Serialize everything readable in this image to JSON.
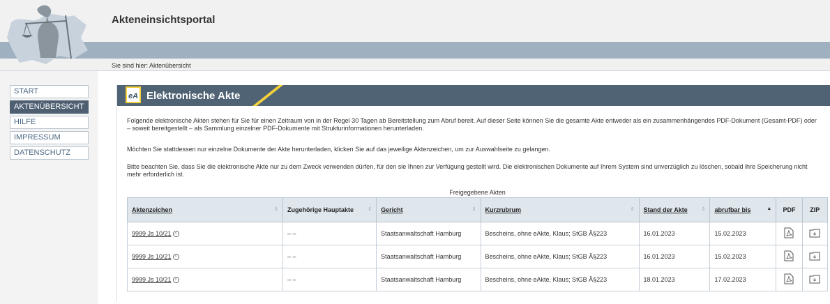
{
  "header": {
    "title": "Akteneinsichtsportal",
    "breadcrumb_label": "Sie sind hier:",
    "breadcrumb_current": "Aktenübersicht"
  },
  "nav": {
    "items": [
      {
        "label": "START",
        "active": false
      },
      {
        "label": "AKTENÜBERSICHT",
        "active": true
      },
      {
        "label": "HILFE",
        "active": false
      },
      {
        "label": "IMPRESSUM",
        "active": false
      },
      {
        "label": "DATENSCHUTZ",
        "active": false
      }
    ]
  },
  "main": {
    "badge": "eA",
    "title": "Elektronische Akte",
    "para1": "Folgende elektronische Akten stehen für Sie für einen Zeitraum von in der Regel 30 Tagen ab Bereitstellung zum Abruf bereit. Auf dieser Seite können Sie die gesamte Akte entweder als ein zusammenhängendes PDF-Dokument (Gesamt-PDF) oder – soweit bereitgestellt – als Sammlung einzelner PDF-Dokumente mit Strukturinformationen herunterladen.",
    "para2": "Möchten Sie stattdessen nur einzelne Dokumente der Akte herunterladen, klicken Sie auf das jeweilige Aktenzeichen, um zur Auswahlseite zu gelangen.",
    "para3": "Bitte beachten Sie, dass Sie die elektronische Akte nur zu dem Zweck verwenden dürfen, für den sie Ihnen zur Verfügung gestellt wird. Die elektronischen Dokumente auf Ihrem System sind unverzüglich zu löschen, sobald ihre Speicherung nicht mehr erforderlich ist."
  },
  "table": {
    "caption": "Freigegebene Akten",
    "headers": {
      "aktenzeichen": "Aktenzeichen",
      "hauptakte": "Zugehörige Hauptakte",
      "gericht": "Gericht",
      "kurzrubrum": "Kurzrubrum",
      "stand": "Stand der Akte",
      "abrufbar": "abrufbar bis",
      "pdf": "PDF",
      "zip": "ZIP"
    },
    "sort_neutral": "⇕",
    "sort_asc": "▲",
    "rows": [
      {
        "aktenzeichen": "9999 Js 10/21",
        "hauptakte": "– –",
        "gericht": "Staatsanwaltschaft Hamburg",
        "kurzrubrum": "Bescheins, ohne eAkte, Klaus; StGB Â§223",
        "stand": "16.01.2023",
        "abrufbar": "15.02.2023"
      },
      {
        "aktenzeichen": "9999 Js 10/21",
        "hauptakte": "– –",
        "gericht": "Staatsanwaltschaft Hamburg",
        "kurzrubrum": "Bescheins, ohne eAkte, Klaus; StGB Â§223",
        "stand": "16.01.2023",
        "abrufbar": "15.02.2023"
      },
      {
        "aktenzeichen": "9999 Js 10/21",
        "hauptakte": "– –",
        "gericht": "Staatsanwaltschaft Hamburg",
        "kurzrubrum": "Bescheins, ohne eAkte, Klaus; StGB Â§223",
        "stand": "18.01.2023",
        "abrufbar": "17.02.2023"
      }
    ]
  },
  "colors": {
    "header_band": "#9fb1c1",
    "title_bar": "#4f6374",
    "accent_yellow": "#f5d23a",
    "nav_active": "#4d5f71"
  },
  "icons": {
    "logo": "justitia-logo",
    "pdf": "pdf-file-icon",
    "zip": "zip-folder-icon",
    "link": "circle-arrow-icon"
  }
}
